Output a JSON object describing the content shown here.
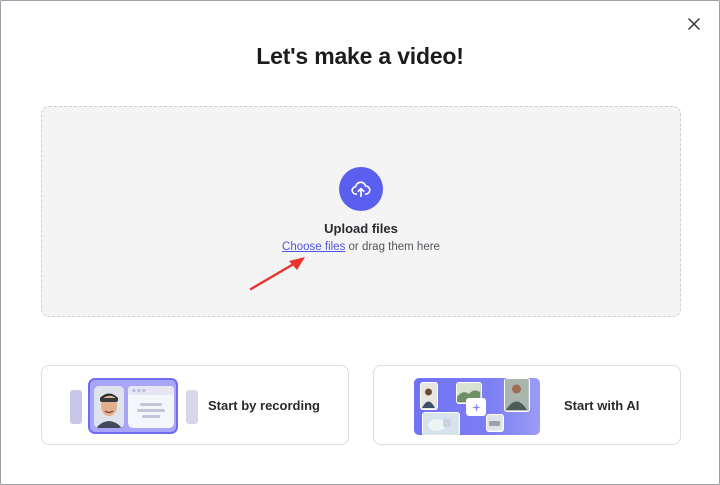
{
  "dialog": {
    "title": "Let's make a video!",
    "close_icon": "close-icon"
  },
  "upload": {
    "icon": "cloud-upload-icon",
    "title": "Upload files",
    "link_label": "Choose files",
    "rest_text": " or drag them here"
  },
  "options": {
    "recording_label": "Start by recording",
    "ai_label": "Start with AI"
  },
  "colors": {
    "accent": "#5b5fef",
    "link": "#4f55e6",
    "annotation_arrow": "#e8342a"
  }
}
